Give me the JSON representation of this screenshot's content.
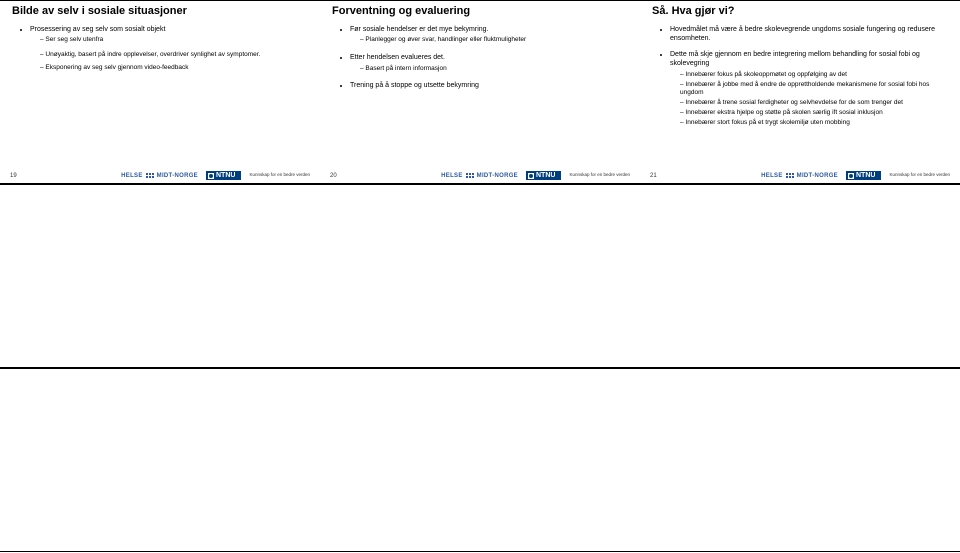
{
  "slides": [
    {
      "page": "19",
      "title": "Bilde av selv i sosiale situasjoner",
      "bullets": [
        {
          "t": "Prosessering av seg selv som sosialt objekt",
          "sub": [
            "Ser seg selv utenfra"
          ]
        },
        {
          "t": "",
          "sub": [
            "Unøyaktig, basert på indre opplevelser, overdriver synlighet av symptomer."
          ]
        },
        {
          "t": "",
          "sub": [
            "Eksponering av seg selv gjennom video-feedback"
          ]
        }
      ],
      "logo1": "HELSE",
      "logo1b": "MIDT-NORGE",
      "logo2": "NTNU",
      "tagline": "Kunnskap for en bedre verden"
    },
    {
      "page": "20",
      "title": "Forventning og evaluering",
      "bullets": [
        {
          "t": "Før sosiale hendelser er det mye bekymring.",
          "sub": [
            "Planlegger og øver svar, handlinger eller fluktmuligheter"
          ]
        },
        {
          "t": "Etter hendelsen evalueres det.",
          "sub": [
            "Basert på intern informasjon"
          ]
        },
        {
          "t": "Trening på å stoppe og utsette bekymring",
          "sub": []
        }
      ],
      "logo1": "HELSE",
      "logo1b": "MIDT-NORGE",
      "logo2": "NTNU",
      "tagline": "Kunnskap for en bedre verden"
    },
    {
      "page": "21",
      "title": "Så. Hva gjør vi?",
      "bullets": [
        {
          "t": "Hovedmålet må være å bedre skolevegrende ungdoms sosiale fungering og redusere ensomheten.",
          "sub": []
        },
        {
          "t": "Dette må skje gjennom en bedre integrering mellom behandling for sosial fobi og skolevegring",
          "sub": [
            "Innebærer fokus på skoleoppmøtet og oppfølging av det",
            "Innebærer å jobbe med å endre de opprettholdende mekanismene for sosial fobi hos ungdom",
            "Innebærer å trene sosial ferdigheter og selvhevdelse for de som trenger det",
            "Innebærer ekstra hjelpe og støtte på skolen særlig ift sosial inklusjon",
            "Innebærer stort fokus på et trygt skolemiljø uten mobbing"
          ]
        }
      ],
      "logo1": "HELSE",
      "logo1b": "MIDT-NORGE",
      "logo2": "NTNU",
      "tagline": "Kunnskap for en bedre verden"
    }
  ]
}
